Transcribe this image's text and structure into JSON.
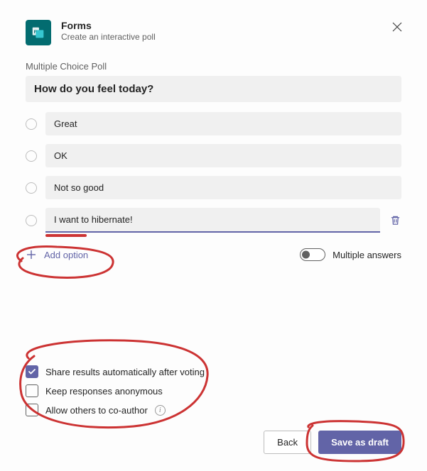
{
  "app": {
    "title": "Forms",
    "subtitle": "Create an interactive poll"
  },
  "poll": {
    "type_label": "Multiple Choice Poll",
    "question": "How do you feel today?",
    "options": [
      {
        "text": "Great"
      },
      {
        "text": "OK"
      },
      {
        "text": "Not so good"
      },
      {
        "text": "I want to hibernate!"
      }
    ],
    "add_option_label": "Add option",
    "multiple_answers_label": "Multiple answers",
    "multiple_answers_enabled": false
  },
  "settings": {
    "share_results": {
      "label": "Share results automatically after voting",
      "checked": true
    },
    "anonymous": {
      "label": "Keep responses anonymous",
      "checked": false
    },
    "coauthor": {
      "label": "Allow others to co-author",
      "checked": false
    }
  },
  "footer": {
    "back": "Back",
    "save": "Save as draft"
  },
  "colors": {
    "accent": "#6264a7",
    "annotation": "#cc3333"
  }
}
